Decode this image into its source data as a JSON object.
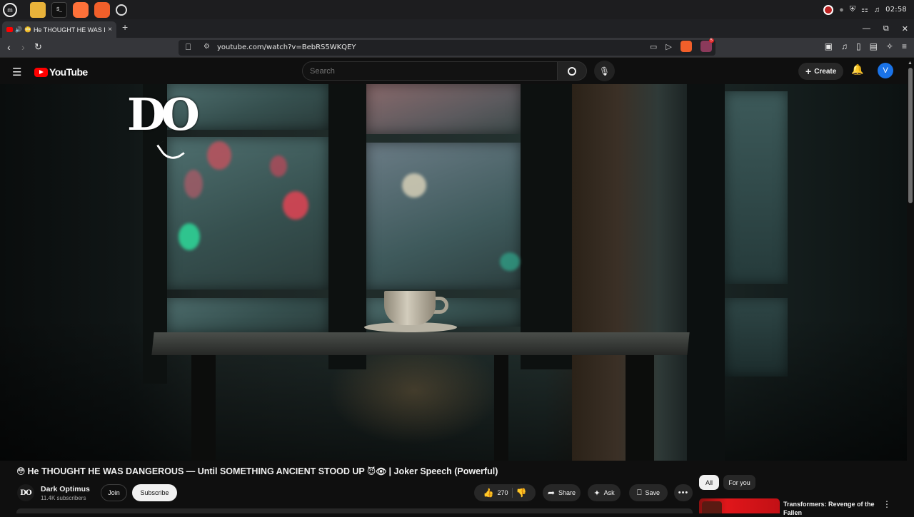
{
  "os": {
    "clock": "02:58",
    "launchers": [
      "mint-menu-icon",
      "files-icon",
      "terminal-icon",
      "firefox-icon",
      "brave-icon",
      "settings-icon"
    ]
  },
  "browser": {
    "tab": {
      "title": "He THOUGHT HE WAS DANGEROUS",
      "close": "×"
    },
    "new_tab": "+",
    "url": "youtube.com/watch?v=BebRS5WKQEY",
    "rewards_count": "5"
  },
  "youtube": {
    "logo_text": "YouTube",
    "search_placeholder": "Search",
    "create_label": "Create",
    "avatar_letter": "V"
  },
  "video": {
    "watermark": "DO",
    "title_emoji_start": "😳",
    "title": "He THOUGHT HE WAS DANGEROUS — Until SOMETHING ANCIENT STOOD UP",
    "title_emoji_end": "😈👁",
    "title_suffix": "| Joker Speech (Powerful)",
    "channel_avatar": "DO",
    "channel_name": "Dark Optimus",
    "subscribers": "11.4K subscribers",
    "join_label": "Join",
    "subscribe_label": "Subscribe",
    "likes": "270",
    "share_label": "Share",
    "ask_label": "Ask",
    "save_label": "Save"
  },
  "sidebar": {
    "chips": [
      "All",
      "For you"
    ],
    "rec_title": "Transformers: Revenge of the Fallen"
  },
  "colors": {
    "youtube_red": "#ff0000",
    "background": "#0f0f0f",
    "avatar_blue": "#1a73e8"
  }
}
